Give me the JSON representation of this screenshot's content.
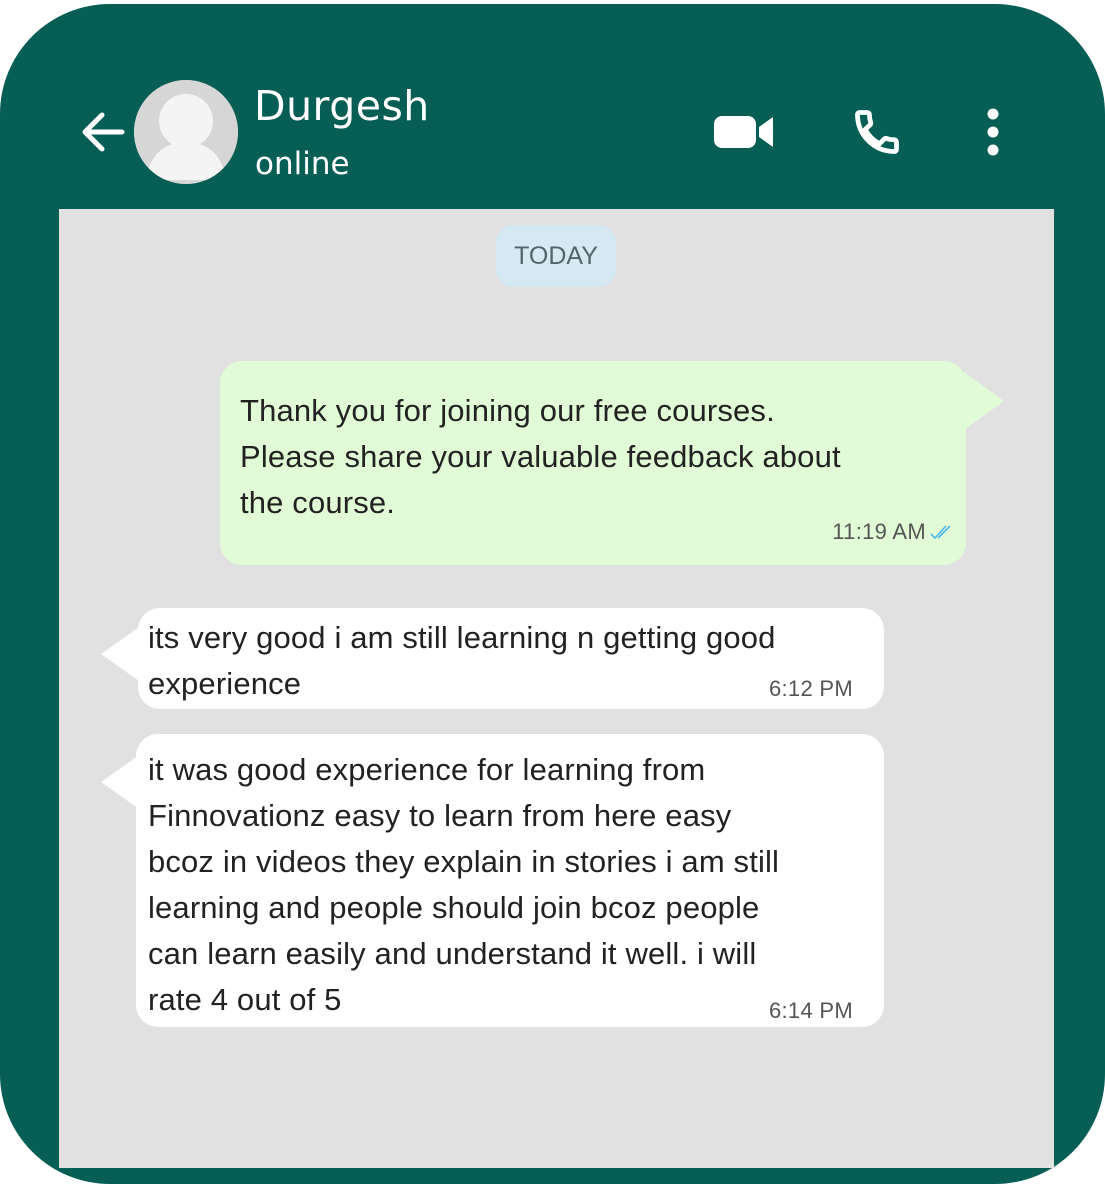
{
  "header": {
    "contact_name": "Durgesh",
    "contact_status": "online",
    "icons": {
      "back": "arrow-left-icon",
      "avatar": "default-avatar-icon",
      "video": "video-call-icon",
      "phone": "voice-call-icon",
      "more": "more-vertical-icon"
    }
  },
  "chat": {
    "date_label": "TODAY",
    "messages": [
      {
        "direction": "outgoing",
        "text": "Thank you for joining our free courses.\nPlease share your valuable feedback about\nthe course.",
        "time": "11:19 AM",
        "status": "read"
      },
      {
        "direction": "incoming",
        "text": "its very good i am still learning n getting good\nexperience",
        "time": "6:12 PM"
      },
      {
        "direction": "incoming",
        "text": "it was good experience for learning from\nFinnovationz easy to learn from here easy\nbcoz in videos they explain in stories i am still\nlearning and people should join bcoz people\ncan learn easily and understand it well. i will\nrate 4 out of  5",
        "time": "6:14 PM"
      }
    ]
  },
  "colors": {
    "header": "#075e55",
    "chat_background": "#e1e1e1",
    "outgoing_bubble": "#e2fbd7",
    "incoming_bubble": "#ffffff",
    "date_chip": "#d5e9f3",
    "read_ticks": "#4fb6ec"
  }
}
